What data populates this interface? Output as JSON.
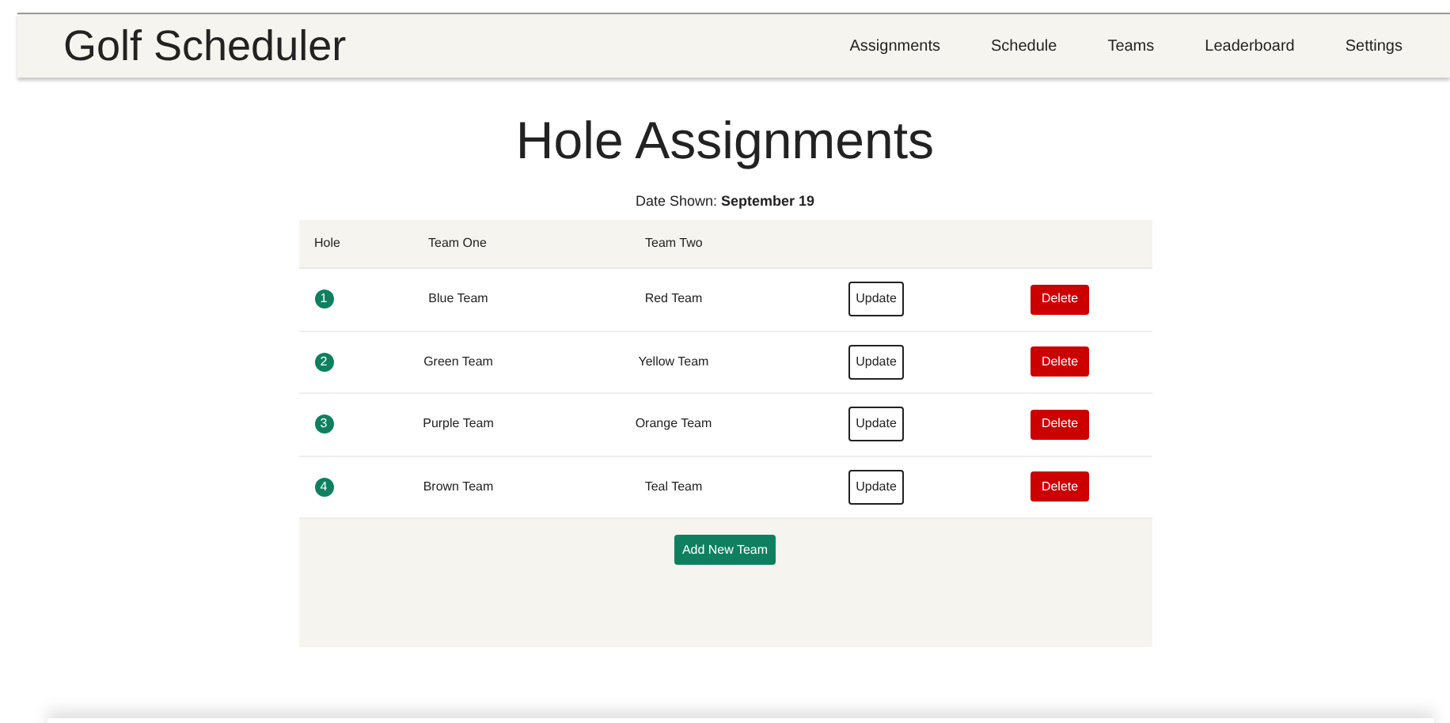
{
  "app_title": "Golf Scheduler",
  "nav": [
    {
      "label": "Assignments"
    },
    {
      "label": "Schedule"
    },
    {
      "label": "Teams"
    },
    {
      "label": "Leaderboard"
    },
    {
      "label": "Settings"
    }
  ],
  "page_title": "Hole Assignments",
  "date_label": "Date Shown:",
  "date_value": "September 19",
  "table": {
    "columns": [
      "Hole",
      "Team One",
      "Team Two"
    ],
    "rows": [
      {
        "hole": "1",
        "team_one": "Blue Team",
        "team_two": "Red Team",
        "update": "Update",
        "delete": "Delete"
      },
      {
        "hole": "2",
        "team_one": "Green Team",
        "team_two": "Yellow Team",
        "update": "Update",
        "delete": "Delete"
      },
      {
        "hole": "3",
        "team_one": "Purple Team",
        "team_two": "Orange Team",
        "update": "Update",
        "delete": "Delete"
      },
      {
        "hole": "4",
        "team_one": "Brown Team",
        "team_two": "Teal Team",
        "update": "Update",
        "delete": "Delete"
      }
    ]
  },
  "add_button": "Add New Team"
}
